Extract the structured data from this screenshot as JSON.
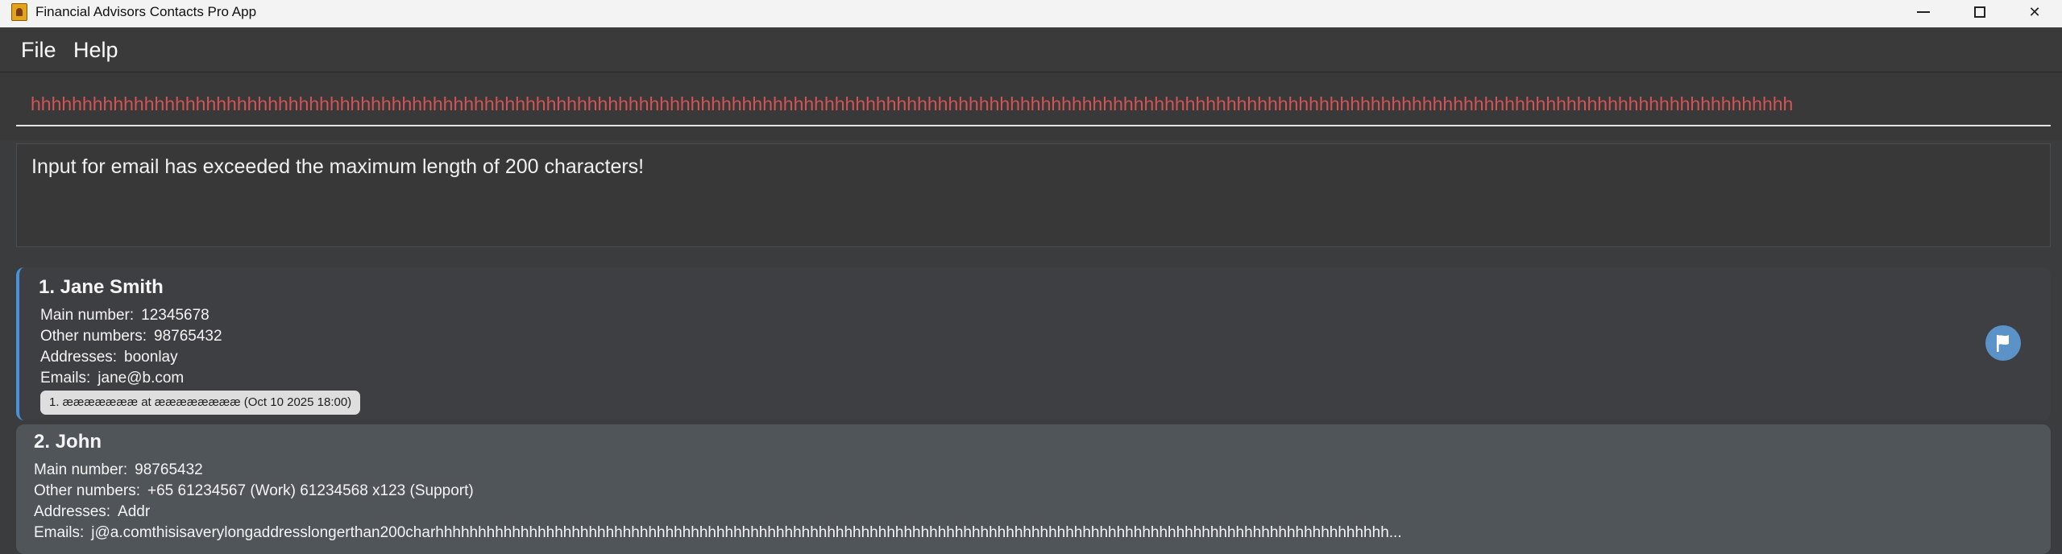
{
  "window": {
    "title": "Financial Advisors Contacts Pro App",
    "minimize_glyph": "",
    "close_glyph": "✕",
    "icons": {
      "app": "app-icon",
      "minimize": "minimize-icon",
      "maximize": "maximize-icon",
      "close": "close-icon"
    }
  },
  "menu": {
    "items": [
      {
        "label": "File"
      },
      {
        "label": "Help"
      }
    ]
  },
  "command": {
    "value": "hhhhhhhhhhhhhhhhhhhhhhhhhhhhhhhhhhhhhhhhhhhhhhhhhhhhhhhhhhhhhhhhhhhhhhhhhhhhhhhhhhhhhhhhhhhhhhhhhhhhhhhhhhhhhhhhhhhhhhhhhhhhhhhhhhhhhhhhhhhhhhhhhhhhhhhhhhhhhhhhhhhhhhhhhhh",
    "text_color": "#d25454"
  },
  "result": {
    "message": "Input for email has exceeded the maximum length of 200 characters!"
  },
  "contacts": [
    {
      "name": "1. Jane Smith",
      "main_label": "Main number:",
      "main": "12345678",
      "other_label": "Other numbers:",
      "other": "98765432",
      "addr_label": "Addresses:",
      "addr": "boonlay",
      "email_label": "Emails:",
      "email": "jane@b.com",
      "meeting": "1. æææææææ at ææææææææ (Oct 10 2025 18:00)",
      "flag_icon": "flag-icon",
      "selected": true,
      "accent": "#4a90d9"
    },
    {
      "name": "2. John",
      "main_label": "Main number:",
      "main": "98765432",
      "other_label": "Other numbers:",
      "other": "+65 61234567 (Work) 61234568 x123 (Support)",
      "addr_label": "Addresses:",
      "addr": "Addr",
      "email_label": "Emails:",
      "email": "j@a.comthisisaverylongaddresslongerthan200charhhhhhhhhhhhhhhhhhhhhhhhhhhhhhhhhhhhhhhhhhhhhhhhhhhhhhhhhhhhhhhhhhhhhhhhhhhhhhhhhhhhhhhhhhhhhhhhhhhhhhhhhhhhhhhhh...",
      "selected": false
    }
  ]
}
